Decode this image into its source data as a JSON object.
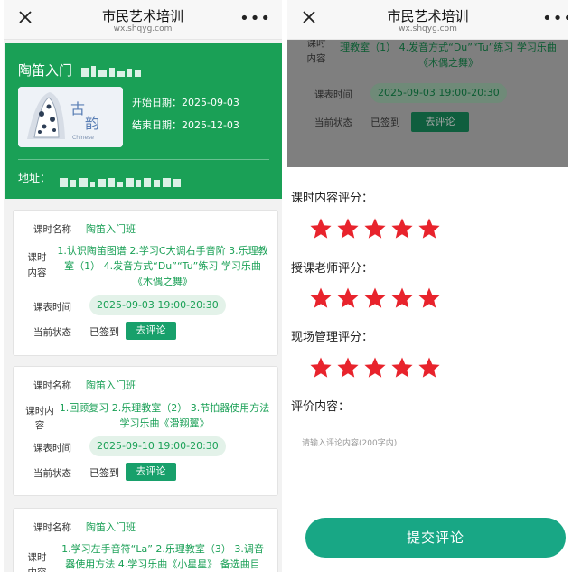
{
  "app": {
    "title": "市民艺术培训",
    "domain": "wx.shqyg.com"
  },
  "course": {
    "title": "陶笛入门",
    "start": "开始日期：2025-09-03",
    "end": "结束日期：2025-12-03",
    "address_label": "地址："
  },
  "labels": {
    "name": "课时名称",
    "content": "课时\n内容",
    "content_alt": "课时内\n容",
    "time": "课表时间",
    "status": "当前状态"
  },
  "lessons": [
    {
      "name": "陶笛入门班",
      "content": "1.认识陶笛图谱 2.学习C大调右手音阶 3.乐理教室（1） 4.发音方式“Du”“Tu”练习 学习乐曲《木偶之舞》",
      "time": "2025-09-03 19:00-20:30",
      "status": "已签到",
      "action": "去评论"
    },
    {
      "name": "陶笛入门班",
      "content": "1.回顾复习 2.乐理教室（2） 3.节拍器使用方法 学习乐曲《滑翔翼》",
      "time": "2025-09-10 19:00-20:30",
      "status": "已签到",
      "action": "去评论"
    },
    {
      "name": "陶笛入门班",
      "content": "1.学习左手音符“La” 2.乐理教室（3） 3.调音器使用方法 4.学习乐曲《小星星》 备选曲目"
    }
  ],
  "right": {
    "lesson_content": "理教室（1） 4.发音方式“Du”“Tu”练习 学习乐曲《木偶之舞》",
    "lesson_time": "2025-09-03 19:00-20:30",
    "lesson_status": "已签到",
    "lesson_action": "去评论",
    "rating_content_label": "课时内容评分：",
    "rating_teacher_label": "授课老师评分：",
    "rating_manage_label": "现场管理评分：",
    "comment_label": "评价内容：",
    "comment_placeholder": "请输入评论内容(200字内)",
    "submit": "提交评论"
  },
  "ratings": {
    "content": 5,
    "teacher": 5,
    "manage": 5,
    "max": 5
  },
  "colors": {
    "primary": "#1aa056",
    "star": "#e8232c",
    "submit": "#18a785"
  },
  "icons": {
    "close": "close-icon",
    "more": "more-icon",
    "star": "star-icon"
  }
}
